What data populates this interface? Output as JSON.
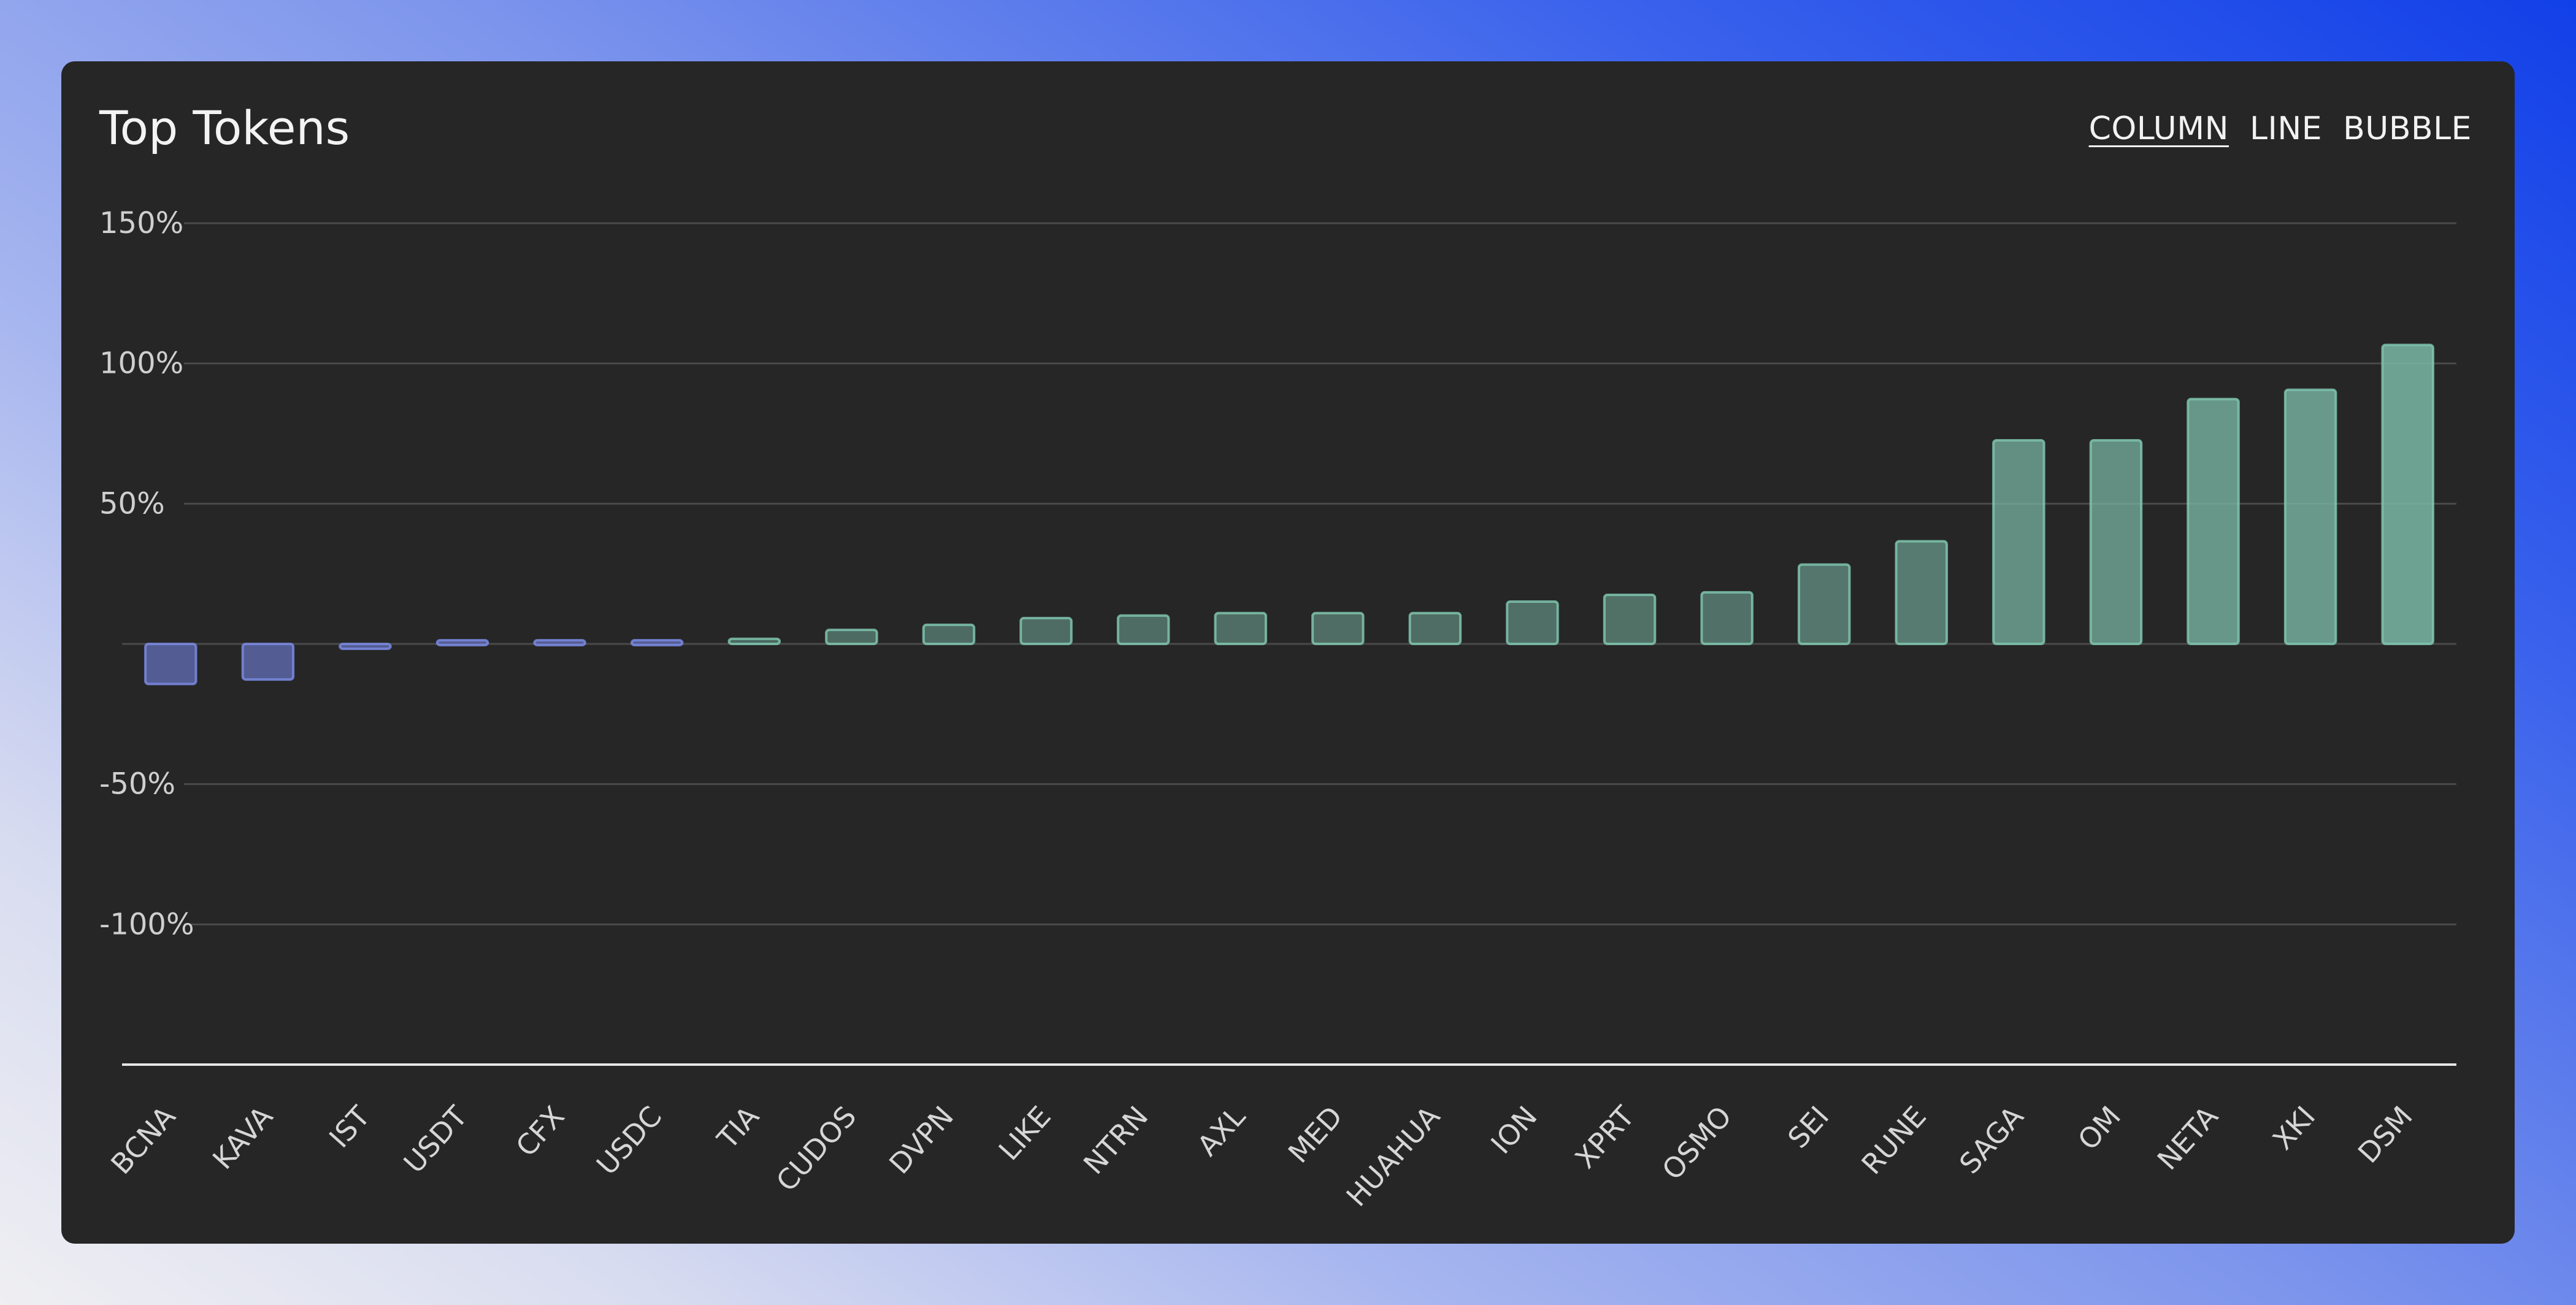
{
  "title": "Top Tokens",
  "tabs": [
    {
      "label": "COLUMN",
      "active": true
    },
    {
      "label": "LINE",
      "active": false
    },
    {
      "label": "BUBBLE",
      "active": false
    }
  ],
  "colors": {
    "background_gradient": [
      "#1240e8",
      "#7d95ec",
      "#efeff2"
    ],
    "card": "#262626",
    "positive_fill": "#7ab8a6",
    "positive_stroke": "#7fc4ae",
    "negative_fill": "#6470b8",
    "negative_stroke": "#7a8ae2",
    "gridline": "#4a4a4a",
    "axis_line": "#e6e6e6"
  },
  "chart_data": {
    "type": "bar",
    "title": "Top Tokens",
    "xlabel": "",
    "ylabel": "",
    "ylim": [
      -150,
      150
    ],
    "yticks": [
      150,
      100,
      50,
      0,
      -50,
      -100
    ],
    "ytick_labels": [
      "150%",
      "100%",
      "50%",
      "",
      "-50%",
      "-100%"
    ],
    "grid": true,
    "legend": "none",
    "categories": [
      "BCNA",
      "KAVA",
      "IST",
      "USDT",
      "CFX",
      "USDC",
      "TIA",
      "CUDOS",
      "DVPN",
      "LIKE",
      "NTRN",
      "AXL",
      "MED",
      "HUAHUA",
      "ION",
      "XPRT",
      "OSMO",
      "SEI",
      "RUNE",
      "SAGA",
      "OM",
      "NETA",
      "XKI",
      "DSM"
    ],
    "values": [
      -14.3,
      -12.7,
      -1.0,
      -0.1,
      -0.1,
      -0.1,
      1.8,
      5.0,
      6.8,
      9.2,
      10.1,
      11.0,
      11.0,
      11.0,
      15.1,
      17.5,
      18.4,
      28.3,
      36.6,
      72.6,
      72.6,
      87.3,
      90.6,
      106.6
    ],
    "unit": "%"
  }
}
